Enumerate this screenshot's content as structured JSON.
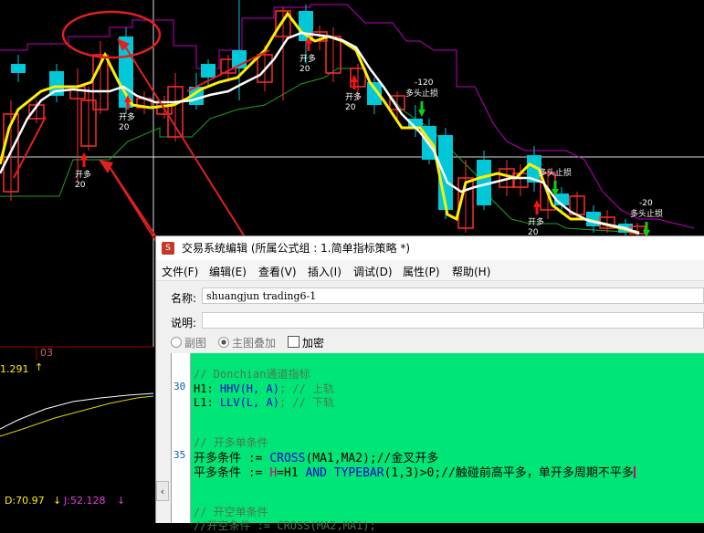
{
  "colors": {
    "up": "#ff2d2d",
    "down": "#00c8d8",
    "ma_white": "#ffffff",
    "ma_yellow": "#ffee00",
    "upper": "#c000c0",
    "lower": "#20a020",
    "arrow_up": "#ff1010",
    "arrow_down": "#10d010",
    "editor_bg": "#00e676"
  },
  "chart": {
    "signals": [
      {
        "label": "开多",
        "value": "20"
      },
      {
        "label": "开多",
        "value": "20"
      },
      {
        "label": "开多",
        "value": "20"
      },
      {
        "label": "开多",
        "value": "20"
      },
      {
        "label": "开多",
        "value": "20"
      }
    ],
    "sell_signals": [
      {
        "label": "多头止损",
        "value": "-120"
      },
      {
        "label": "多头止损",
        "value": ""
      },
      {
        "label": "多头止损",
        "value": "-20"
      }
    ]
  },
  "indicator": {
    "period_label": "03",
    "value_left": "1.291",
    "d_value": "D:70.97",
    "j_value": "J:52.128"
  },
  "dialog": {
    "title": "交易系统编辑 (所属公式组 : 1.简单指标策略 *)",
    "menu": [
      "文件(F)",
      "编辑(E)",
      "查看(V)",
      "插入(I)",
      "调试(D)",
      "属性(P)",
      "帮助(H)"
    ],
    "name_label": "名称:",
    "name_value": "shuangjun trading6-1",
    "desc_label": "说明:",
    "opt_sub": "副图",
    "opt_main": "主图叠加",
    "opt_encrypt": "加密",
    "code": {
      "c1": "// Donchian通道指标",
      "h1a": "H1: ",
      "h1b": "HHV(H, A)",
      "h1c": "; // 上轨",
      "l1a": "L1: ",
      "l1b": "LLV(L, A)",
      "l1c": "; // 下轨",
      "c2": "// 开多单条件",
      "k1a": "开多条件 := ",
      "k1b": "CROSS",
      "k1c": "(MA1,MA2);//金叉开多",
      "k2a": "平多条件 := ",
      "k2b": "H",
      "k2c": "=H1 ",
      "k2d": "AND",
      "k2e": " ",
      "k2f": "TYPEBAR",
      "k2g": "(1,3)>0;//触碰前高平多，单开多周期不平多",
      "c3": "// 开空单条件",
      "c4": "//开空条件 := CROSS(MA2,MA1);",
      "ln30": "30",
      "ln35": "35"
    }
  }
}
